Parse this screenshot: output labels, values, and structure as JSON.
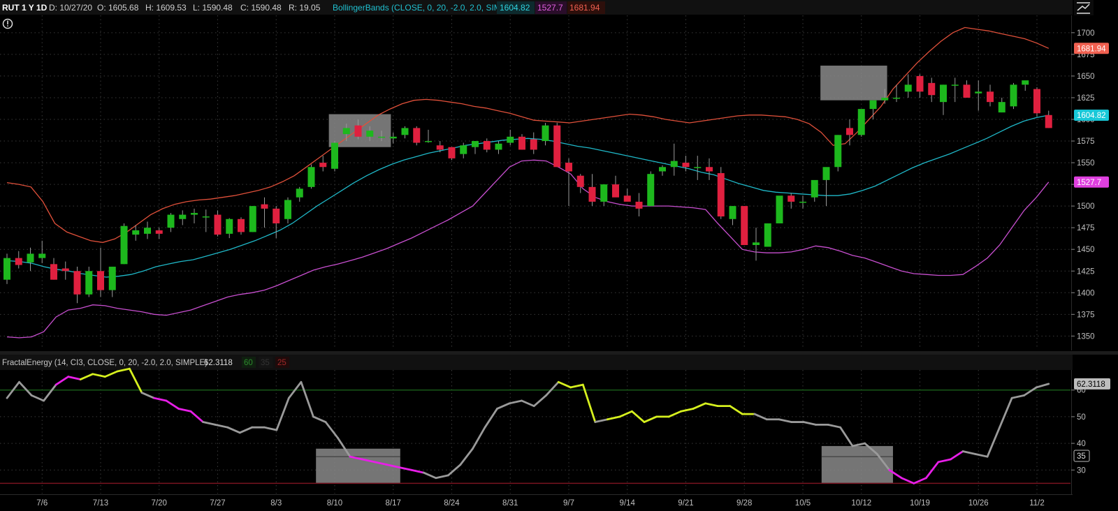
{
  "header": {
    "symbol": "RUT 1 Y 1D",
    "date": "D: 10/27/20",
    "open": "O: 1605.68",
    "high": "H: 1609.53",
    "low": "L: 1590.48",
    "close": "C: 1590.48",
    "range": "R: 19.05",
    "study": "BollingerBands (CLOSE, 0, 20, -2.0, 2.0, SIMPLE)",
    "mid": "1604.82",
    "lower": "1527.7",
    "upper": "1681.94",
    "info_icon": "alert-info-icon",
    "expand_icon": "expand-chart-icon"
  },
  "lower_header": {
    "study": "FractalEnergy (14, CI3, CLOSE, 0, 20, -2.0, 2.0, SIMPLE)",
    "value": "62.3118",
    "level_hi": "60",
    "level_mid": "35",
    "level_lo": "25"
  },
  "price_badges": {
    "upper": "1681.94",
    "mid": "1604.82",
    "lower": "1527.7"
  },
  "fe_badges": {
    "value": "62.3118",
    "mid": "35"
  },
  "colors": {
    "up": "#1db81d",
    "down": "#e0203f",
    "mid_band": "#1fb8c8",
    "upper_band": "#e0503a",
    "lower_band": "#c84fd0",
    "fe_gray": "#9a9a9a",
    "fe_yellow": "#d6f01e",
    "fe_magenta": "#e81ee8",
    "grid": "#3a3a3a",
    "highlight": "#8a8a8a"
  },
  "chart_data": [
    {
      "type": "candlestick",
      "title": "RUT 1 Y 1D",
      "xlim": [
        0,
        84
      ],
      "ylim": [
        1335,
        1720
      ],
      "y_ticks": [
        1350,
        1375,
        1400,
        1425,
        1450,
        1475,
        1500,
        1525,
        1550,
        1575,
        1600,
        1625,
        1650,
        1675,
        1700
      ],
      "x_ticks": [
        {
          "label": "7/6",
          "i": 3
        },
        {
          "label": "7/13",
          "i": 8
        },
        {
          "label": "7/20",
          "i": 13
        },
        {
          "label": "7/27",
          "i": 18
        },
        {
          "label": "8/3",
          "i": 23
        },
        {
          "label": "8/10",
          "i": 28
        },
        {
          "label": "8/17",
          "i": 33
        },
        {
          "label": "8/24",
          "i": 38
        },
        {
          "label": "8/31",
          "i": 43
        },
        {
          "label": "9/7",
          "i": 48
        },
        {
          "label": "9/14",
          "i": 53
        },
        {
          "label": "9/21",
          "i": 58
        },
        {
          "label": "9/28",
          "i": 63
        },
        {
          "label": "10/5",
          "i": 68
        },
        {
          "label": "10/12",
          "i": 73
        },
        {
          "label": "10/19",
          "i": 78
        },
        {
          "label": "10/26",
          "i": 83
        },
        {
          "label": "11/2",
          "i": 88
        }
      ],
      "grid": true,
      "candles": [
        [
          1415,
          1445,
          1410,
          1440
        ],
        [
          1440,
          1448,
          1428,
          1432
        ],
        [
          1435,
          1452,
          1425,
          1445
        ],
        [
          1440,
          1460,
          1434,
          1445
        ],
        [
          1433,
          1440,
          1415,
          1415
        ],
        [
          1428,
          1436,
          1415,
          1425
        ],
        [
          1425,
          1430,
          1388,
          1398
        ],
        [
          1398,
          1430,
          1395,
          1425
        ],
        [
          1425,
          1452,
          1395,
          1403
        ],
        [
          1403,
          1430,
          1395,
          1430
        ],
        [
          1433,
          1480,
          1433,
          1477
        ],
        [
          1467,
          1478,
          1460,
          1472
        ],
        [
          1468,
          1482,
          1462,
          1475
        ],
        [
          1472,
          1475,
          1462,
          1468
        ],
        [
          1475,
          1492,
          1470,
          1490
        ],
        [
          1485,
          1495,
          1478,
          1490
        ],
        [
          1490,
          1497,
          1480,
          1492
        ],
        [
          1488,
          1496,
          1470,
          1488
        ],
        [
          1490,
          1495,
          1465,
          1467
        ],
        [
          1468,
          1486,
          1463,
          1485
        ],
        [
          1485,
          1487,
          1467,
          1470
        ],
        [
          1470,
          1500,
          1470,
          1500
        ],
        [
          1502,
          1510,
          1475,
          1497
        ],
        [
          1497,
          1500,
          1463,
          1480
        ],
        [
          1485,
          1510,
          1480,
          1507
        ],
        [
          1510,
          1522,
          1505,
          1520
        ],
        [
          1522,
          1548,
          1520,
          1545
        ],
        [
          1550,
          1558,
          1540,
          1545
        ],
        [
          1543,
          1575,
          1540,
          1573
        ],
        [
          1583,
          1595,
          1575,
          1590
        ],
        [
          1593,
          1600,
          1577,
          1580
        ],
        [
          1580,
          1592,
          1575,
          1587
        ],
        [
          1580,
          1587,
          1575,
          1580
        ],
        [
          1578,
          1585,
          1572,
          1580
        ],
        [
          1582,
          1592,
          1578,
          1590
        ],
        [
          1590,
          1592,
          1570,
          1573
        ],
        [
          1575,
          1588,
          1573,
          1575
        ],
        [
          1570,
          1575,
          1562,
          1565
        ],
        [
          1568,
          1568,
          1553,
          1555
        ],
        [
          1560,
          1573,
          1555,
          1570
        ],
        [
          1568,
          1575,
          1560,
          1575
        ],
        [
          1575,
          1578,
          1562,
          1565
        ],
        [
          1565,
          1575,
          1560,
          1572
        ],
        [
          1573,
          1588,
          1570,
          1580
        ],
        [
          1580,
          1583,
          1565,
          1565
        ],
        [
          1577,
          1585,
          1560,
          1565
        ],
        [
          1575,
          1596,
          1570,
          1593
        ],
        [
          1593,
          1596,
          1545,
          1545
        ],
        [
          1550,
          1555,
          1500,
          1540
        ],
        [
          1535,
          1537,
          1515,
          1522
        ],
        [
          1522,
          1537,
          1500,
          1505
        ],
        [
          1505,
          1525,
          1500,
          1525
        ],
        [
          1525,
          1535,
          1512,
          1510
        ],
        [
          1512,
          1520,
          1505,
          1505
        ],
        [
          1505,
          1515,
          1488,
          1497
        ],
        [
          1500,
          1540,
          1500,
          1537
        ],
        [
          1540,
          1547,
          1535,
          1545
        ],
        [
          1545,
          1572,
          1535,
          1552
        ],
        [
          1550,
          1558,
          1540,
          1545
        ],
        [
          1545,
          1558,
          1530,
          1545
        ],
        [
          1545,
          1555,
          1530,
          1540
        ],
        [
          1538,
          1545,
          1485,
          1488
        ],
        [
          1485,
          1500,
          1478,
          1500
        ],
        [
          1500,
          1500,
          1455,
          1455
        ],
        [
          1455,
          1475,
          1437,
          1458
        ],
        [
          1453,
          1480,
          1453,
          1480
        ],
        [
          1480,
          1500,
          1480,
          1512
        ],
        [
          1512,
          1515,
          1497,
          1505
        ],
        [
          1505,
          1512,
          1497,
          1505
        ],
        [
          1510,
          1522,
          1505,
          1530
        ],
        [
          1530,
          1540,
          1500,
          1545
        ],
        [
          1545,
          1582,
          1540,
          1582
        ],
        [
          1590,
          1600,
          1570,
          1582
        ],
        [
          1582,
          1590,
          1580,
          1612
        ],
        [
          1612,
          1620,
          1600,
          1622
        ],
        [
          1622,
          1635,
          1618,
          1625
        ],
        [
          1625,
          1640,
          1620,
          1625
        ],
        [
          1632,
          1652,
          1625,
          1640
        ],
        [
          1650,
          1652,
          1625,
          1632
        ],
        [
          1642,
          1648,
          1620,
          1628
        ],
        [
          1620,
          1640,
          1605,
          1640
        ],
        [
          1640,
          1648,
          1620,
          1640
        ],
        [
          1640,
          1645,
          1625,
          1625
        ],
        [
          1630,
          1645,
          1610,
          1632
        ],
        [
          1632,
          1640,
          1615,
          1620
        ],
        [
          1608,
          1625,
          1608,
          1620
        ],
        [
          1615,
          1642,
          1612,
          1640
        ],
        [
          1640,
          1640,
          1633,
          1645
        ],
        [
          1635,
          1637,
          1603,
          1607
        ],
        [
          1605,
          1610,
          1590,
          1590
        ]
      ],
      "bands": {
        "upper": [
          1527,
          1525,
          1522,
          1505,
          1480,
          1470,
          1465,
          1460,
          1458,
          1462,
          1470,
          1480,
          1490,
          1497,
          1502,
          1505,
          1507,
          1508,
          1510,
          1512,
          1515,
          1518,
          1522,
          1528,
          1535,
          1545,
          1555,
          1565,
          1575,
          1585,
          1595,
          1605,
          1612,
          1618,
          1622,
          1623,
          1622,
          1620,
          1618,
          1615,
          1613,
          1610,
          1607,
          1603,
          1599,
          1598,
          1597,
          1596,
          1598,
          1600,
          1602,
          1604,
          1606,
          1605,
          1603,
          1600,
          1598,
          1596,
          1598,
          1600,
          1602,
          1604,
          1605,
          1605,
          1604,
          1603,
          1600,
          1595,
          1585,
          1570,
          1572,
          1585,
          1600,
          1615,
          1635,
          1650,
          1665,
          1678,
          1690,
          1700,
          1706,
          1704,
          1702,
          1699,
          1696,
          1693,
          1688,
          1681.94
        ],
        "mid": [
          1437,
          1436,
          1434,
          1430,
          1427,
          1425,
          1422,
          1420,
          1418,
          1419,
          1421,
          1425,
          1430,
          1433,
          1436,
          1438,
          1442,
          1446,
          1450,
          1455,
          1460,
          1466,
          1472,
          1480,
          1490,
          1500,
          1509,
          1518,
          1527,
          1535,
          1542,
          1548,
          1553,
          1557,
          1561,
          1564,
          1567,
          1570,
          1572,
          1574,
          1576,
          1577,
          1578,
          1577,
          1575,
          1572,
          1569,
          1567,
          1564,
          1561,
          1558,
          1555,
          1552,
          1549,
          1546,
          1543,
          1539,
          1536,
          1531,
          1526,
          1522,
          1518,
          1516,
          1515,
          1514,
          1513,
          1512,
          1512,
          1514,
          1518,
          1523,
          1530,
          1537,
          1544,
          1550,
          1555,
          1560,
          1566,
          1572,
          1578,
          1585,
          1592,
          1598,
          1602,
          1604.82
        ],
        "lower": [
          1349,
          1348,
          1349,
          1355,
          1372,
          1380,
          1382,
          1386,
          1385,
          1382,
          1380,
          1378,
          1375,
          1374,
          1377,
          1380,
          1385,
          1390,
          1395,
          1398,
          1400,
          1403,
          1408,
          1414,
          1420,
          1426,
          1430,
          1433,
          1437,
          1441,
          1446,
          1451,
          1457,
          1463,
          1470,
          1477,
          1484,
          1492,
          1500,
          1515,
          1530,
          1545,
          1552,
          1553,
          1552,
          1545,
          1537,
          1520,
          1510,
          1505,
          1502,
          1500,
          1500,
          1500,
          1500,
          1499,
          1498,
          1496,
          1480,
          1465,
          1450,
          1447,
          1446,
          1446,
          1447,
          1450,
          1454,
          1452,
          1448,
          1443,
          1440,
          1435,
          1430,
          1425,
          1422,
          1421,
          1420,
          1420,
          1421,
          1430,
          1440,
          1455,
          1475,
          1495,
          1510,
          1527.7
        ]
      }
    },
    {
      "type": "line",
      "title": "FractalEnergy (14, CI3, CLOSE, 0, 20, -2.0, 2.0, SIMPLE)",
      "xlim": [
        0,
        84
      ],
      "ylim": [
        23,
        67
      ],
      "y_ticks": [
        30,
        40,
        50,
        60
      ],
      "levels": {
        "hi": 60,
        "lo": 25
      },
      "series": [
        {
          "values": [
            57,
            63,
            58,
            56,
            62,
            65,
            64,
            66,
            65,
            67,
            68,
            59,
            57,
            56,
            53,
            52,
            48,
            47,
            46,
            44,
            46,
            46,
            45,
            57,
            63,
            50,
            48,
            42,
            35,
            34,
            33,
            32,
            31,
            30,
            29,
            27,
            28,
            32,
            38,
            46,
            53,
            55,
            56,
            54,
            58,
            63,
            61,
            62,
            48,
            49,
            50,
            52,
            48,
            50,
            50,
            52,
            53,
            55,
            54,
            54,
            51,
            51,
            49,
            49,
            48,
            48,
            47,
            47,
            46,
            39,
            40,
            36,
            30,
            27,
            25,
            27,
            33,
            34,
            37,
            36,
            35,
            46,
            57,
            58,
            61,
            62.3118
          ],
          "colors": "ggggmmyyyyygmmmmggggggggggggmmmmmmgggggggggggyyygyyyyyyyyyyyygggggggggggmmmmmmgggggg"
        }
      ]
    }
  ]
}
